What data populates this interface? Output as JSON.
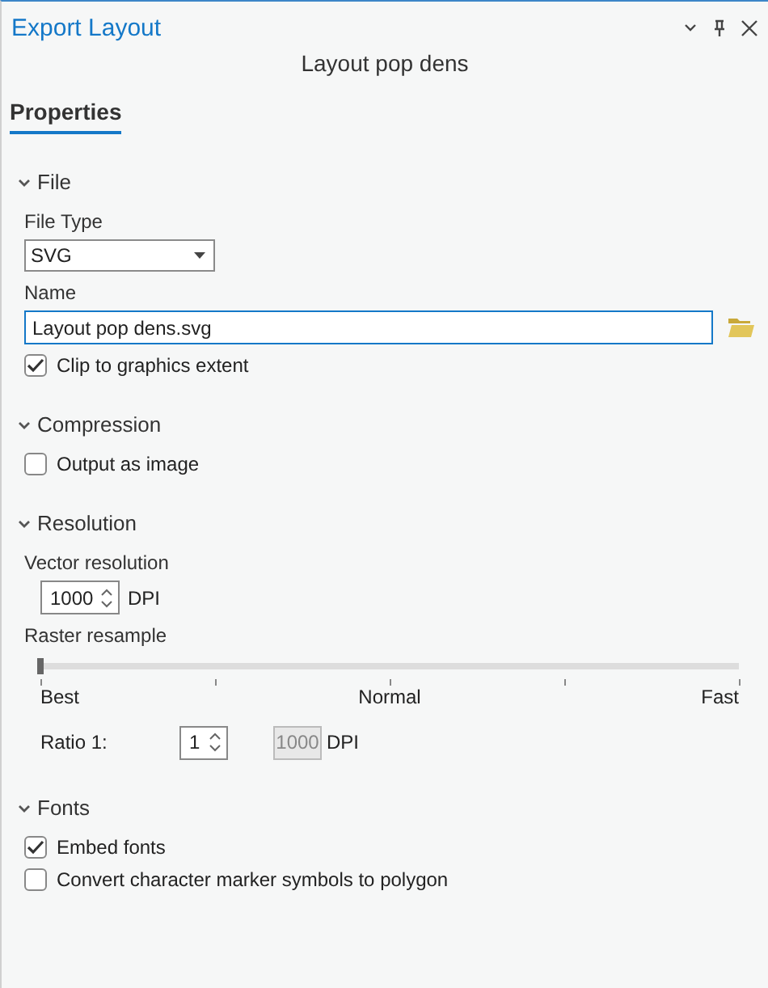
{
  "window": {
    "title": "Export Layout",
    "subtitle": "Layout pop dens"
  },
  "tabs": [
    {
      "label": "Properties",
      "selected": true
    }
  ],
  "sections": [
    {
      "title": "File",
      "expanded": true,
      "items": [
        {
          "kind": "select",
          "label": "File Type",
          "value": "SVG"
        },
        {
          "kind": "text",
          "label": "Name",
          "value": "Layout pop dens.svg"
        },
        {
          "kind": "checkbox",
          "label": "Clip to graphics extent",
          "checked": true
        }
      ]
    },
    {
      "title": "Compression",
      "expanded": true,
      "items": [
        {
          "kind": "checkbox",
          "label": "Output as image",
          "checked": false
        }
      ]
    },
    {
      "title": "Resolution",
      "expanded": true,
      "items": [
        {
          "kind": "spinner",
          "label": "Vector resolution",
          "value": "1000",
          "unit": "DPI"
        },
        {
          "kind": "slider",
          "label": "Raster resample",
          "level": 0,
          "marks": [
            "Best",
            "Normal",
            "Fast"
          ]
        },
        {
          "kind": "ratio",
          "label": "Ratio 1:",
          "value": "1",
          "dpi": "1000",
          "unit": "DPI"
        }
      ]
    },
    {
      "title": "Fonts",
      "expanded": true,
      "items": [
        {
          "kind": "checkbox",
          "label": "Embed fonts",
          "checked": true
        },
        {
          "kind": "checkbox",
          "label": "Convert character marker symbols to polygon",
          "checked": false
        }
      ]
    }
  ]
}
